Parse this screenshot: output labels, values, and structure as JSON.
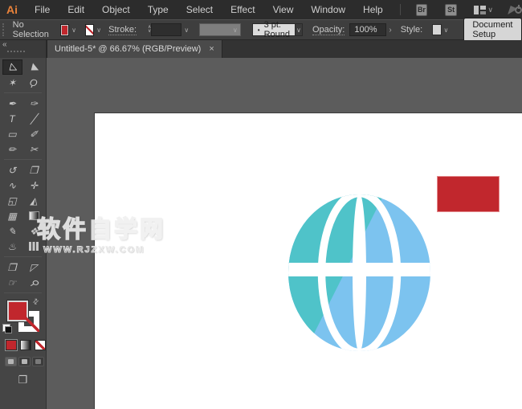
{
  "menu": {
    "logo": "Ai",
    "items": [
      "File",
      "Edit",
      "Object",
      "Type",
      "Select",
      "Effect",
      "View",
      "Window",
      "Help"
    ],
    "br_label": "Br",
    "st_label": "St"
  },
  "control_bar": {
    "selection_status": "No Selection",
    "stroke_label": "Stroke:",
    "brush_bullet": "•",
    "brush_stroke_value": "3 pt. Round",
    "opacity_label": "Opacity:",
    "opacity_value": "100%",
    "style_label": "Style:",
    "document_setup_label": "Document Setup"
  },
  "tab": {
    "title": "Untitled-5* @ 66.67% (RGB/Preview)",
    "close": "×",
    "collapse": "«"
  },
  "icons": {
    "chevron": "∨",
    "stepper_up": "∧",
    "stepper_down": "∨",
    "arrow_right": "›",
    "swap": "⇄",
    "screen_mode": "❐"
  },
  "tools": [
    {
      "name": "selection",
      "glyph": "▷"
    },
    {
      "name": "direct-selection",
      "glyph": "▶"
    },
    {
      "name": "magic-wand",
      "glyph": "✶"
    },
    {
      "name": "lasso",
      "glyph": "Ϙ"
    },
    {
      "name": "pen",
      "glyph": "✒"
    },
    {
      "name": "curvature",
      "glyph": "✑"
    },
    {
      "name": "type",
      "glyph": "T"
    },
    {
      "name": "line-segment",
      "glyph": "╱"
    },
    {
      "name": "rectangle",
      "glyph": "▭"
    },
    {
      "name": "paintbrush",
      "glyph": "✐"
    },
    {
      "name": "pencil",
      "glyph": "✏"
    },
    {
      "name": "scissors",
      "glyph": "✂"
    },
    {
      "name": "rotate",
      "glyph": "↺"
    },
    {
      "name": "scale",
      "glyph": "❐"
    },
    {
      "name": "width",
      "glyph": "∿"
    },
    {
      "name": "free-transform",
      "glyph": "✛"
    },
    {
      "name": "shape-builder",
      "glyph": "◱"
    },
    {
      "name": "perspective-grid",
      "glyph": "◭"
    },
    {
      "name": "mesh",
      "glyph": "▦"
    },
    {
      "name": "gradient",
      "glyph": ""
    },
    {
      "name": "eyedropper",
      "glyph": "✎"
    },
    {
      "name": "blend",
      "glyph": "❖"
    },
    {
      "name": "symbol-sprayer",
      "glyph": "♨"
    },
    {
      "name": "column-graph",
      "glyph": ""
    },
    {
      "name": "artboard",
      "glyph": "❒"
    },
    {
      "name": "slice",
      "glyph": "◸"
    },
    {
      "name": "hand",
      "glyph": "☞"
    },
    {
      "name": "zoom",
      "glyph": "⚲"
    }
  ],
  "swatches": {
    "fill_color": "#C1272D"
  },
  "canvas": {
    "globe": {
      "blue": "#7CC3EF",
      "teal": "#4FC3C9"
    },
    "rectangle": {
      "color": "#C1272D"
    }
  },
  "watermark": {
    "line1": "软件自学网",
    "line2": "WWW.RJZXW.COM"
  }
}
